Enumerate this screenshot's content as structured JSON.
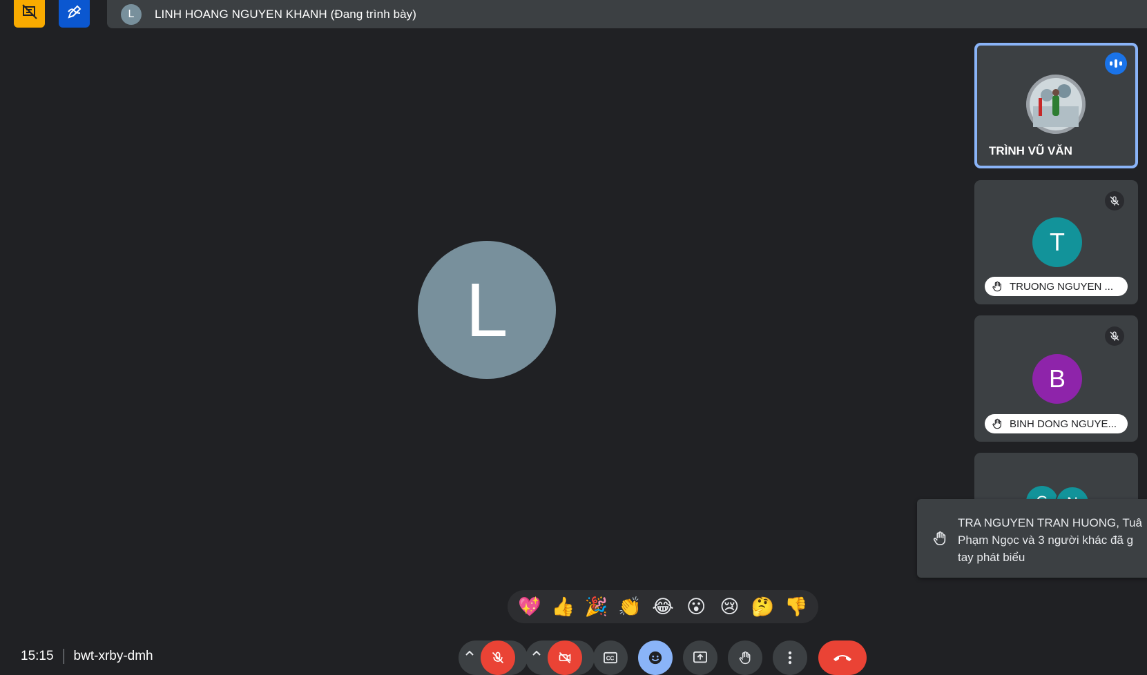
{
  "topbar": {
    "presenter_initial": "L",
    "presenter_label": "LINH HOANG NGUYEN KHANH (Đang trình bày)"
  },
  "stage": {
    "initial": "L",
    "avatar_color": "#78909c"
  },
  "participants": [
    {
      "name": "TRÌNH VŨ VĂN",
      "state": "speaking",
      "photo": true
    },
    {
      "name": "TRUONG NGUYEN ...",
      "initial": "T",
      "color": "#12939a",
      "hand_raised": true,
      "muted": true
    },
    {
      "name": "BINH DONG NGUYE...",
      "initial": "B",
      "color": "#8e24aa",
      "hand_raised": true,
      "muted": true
    }
  ],
  "partial_tile": {
    "initials": [
      "G",
      "N"
    ],
    "color": "#12939a"
  },
  "toast": {
    "line1": "TRA NGUYEN TRAN HUONG, Tuâ",
    "line2": "Phạm Ngọc và 3 người khác đã g",
    "line3": "tay phát biểu"
  },
  "reactions": [
    "💖",
    "👍",
    "🎉",
    "👏",
    "😂",
    "😮",
    "😢",
    "🤔",
    "👎"
  ],
  "footer": {
    "time": "15:15",
    "meeting_code": "bwt-xrby-dmh"
  },
  "colors": {
    "background": "#202124",
    "surface": "#3c4043",
    "accent": "#8ab4f8",
    "danger": "#ea4335"
  }
}
